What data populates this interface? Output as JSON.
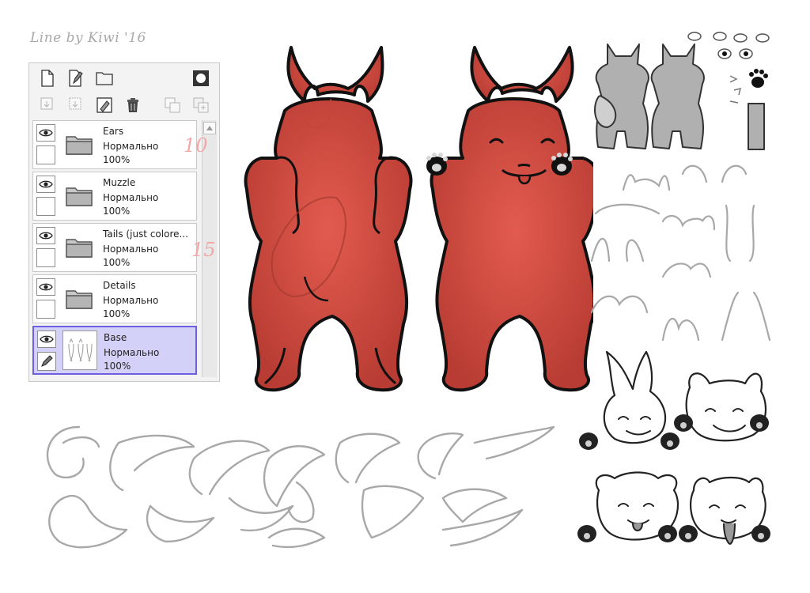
{
  "signature": "Line by Kiwi '16",
  "layers": [
    {
      "name": "Ears",
      "mode": "Нормально",
      "opacity": "100%",
      "type": "folder"
    },
    {
      "name": "Muzzle",
      "mode": "Нормально",
      "opacity": "100%",
      "type": "folder"
    },
    {
      "name": "Tails (just colore...",
      "mode": "Нормально",
      "opacity": "100%",
      "type": "folder"
    },
    {
      "name": "Details",
      "mode": "Нормально",
      "opacity": "100%",
      "type": "folder"
    },
    {
      "name": "Base",
      "mode": "Нормально",
      "opacity": "100%",
      "type": "layer",
      "selected": true
    }
  ],
  "notes": [
    "10",
    "15"
  ],
  "colors": {
    "body": "#dd5045",
    "outline": "#111111",
    "sketch": "#a8a8a8",
    "selection": "#d4d1f8",
    "note": "#f2a8a8"
  }
}
